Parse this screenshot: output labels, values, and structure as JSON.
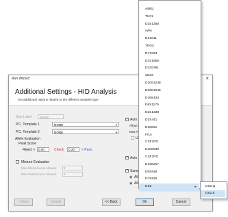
{
  "window": {
    "title": "Run Wizard",
    "heading": "Additional Settings - HID Analysis",
    "subheading": "Set additional options related to the different analysis type"
  },
  "form": {
    "size_label": "Size Label",
    "size_value": "NONE",
    "pc_template1_label": "P.C. Template 1",
    "pc_template1_value": "NONE",
    "pc_template2_label": "P.C. Template 2",
    "pc_template2_value": "NONE",
    "allele_evaluation": "Allele Evaluation",
    "peak_score": "Peak Score",
    "reject_label": "Reject <",
    "reject_value": "0.00",
    "check_label": "Check",
    "pass_value": "0.20",
    "pass_label": "< Pass",
    "mixture_evaluation": "Mixture Evaluation",
    "max_alleles_label": "Max Alleles/Locus Allowed",
    "max_alleles_value": "3",
    "max_peaks_label": "Max Peaks/Locus Allowed",
    "max_peaks_value": "3"
  },
  "right_panel": {
    "auto_sizing": "Auto Si",
    "allow_label": "Allow Mul",
    "max_label": "Max # of",
    "use_label": "Use L",
    "auto_panel": "Auto Par",
    "sample_label": "Sample C",
    "radio_allele1": "Allele",
    "radio_allele2": "Allele"
  },
  "buttons": {
    "save": "Save",
    "cancel_dim": "Cancel",
    "back": "<< Back",
    "ok": "Ok",
    "cancel": "Cancel"
  },
  "menu_items": [
    {
      "label": "AMEL"
    },
    {
      "label": "TH01"
    },
    {
      "label": "D3S1358"
    },
    {
      "label": "vWA"
    },
    {
      "label": "D21S11"
    },
    {
      "label": "TPOX"
    },
    {
      "label": "DYS391"
    },
    {
      "label": "D1S1656"
    },
    {
      "label": "D12S391"
    },
    {
      "label": "SE33"
    },
    {
      "label": "D10S1248"
    },
    {
      "label": "D22S1045"
    },
    {
      "label": "D19S433"
    },
    {
      "label": "D8S1179"
    },
    {
      "label": "D2S1338"
    },
    {
      "label": "D2S441"
    },
    {
      "label": "D18S51"
    },
    {
      "label": "FGA"
    },
    {
      "label": "CSF1PO"
    },
    {
      "label": "D16S539"
    },
    {
      "label": "CSF1PO"
    },
    {
      "label": "D13S317"
    },
    {
      "label": "D5S818"
    },
    {
      "label": "D7S820"
    },
    {
      "label": "DS2",
      "has_submenu": true,
      "selected": true
    }
  ],
  "submenu_items": [
    {
      "label": "DS2.Q"
    },
    {
      "label": "DS2.5",
      "selected": true
    }
  ]
}
